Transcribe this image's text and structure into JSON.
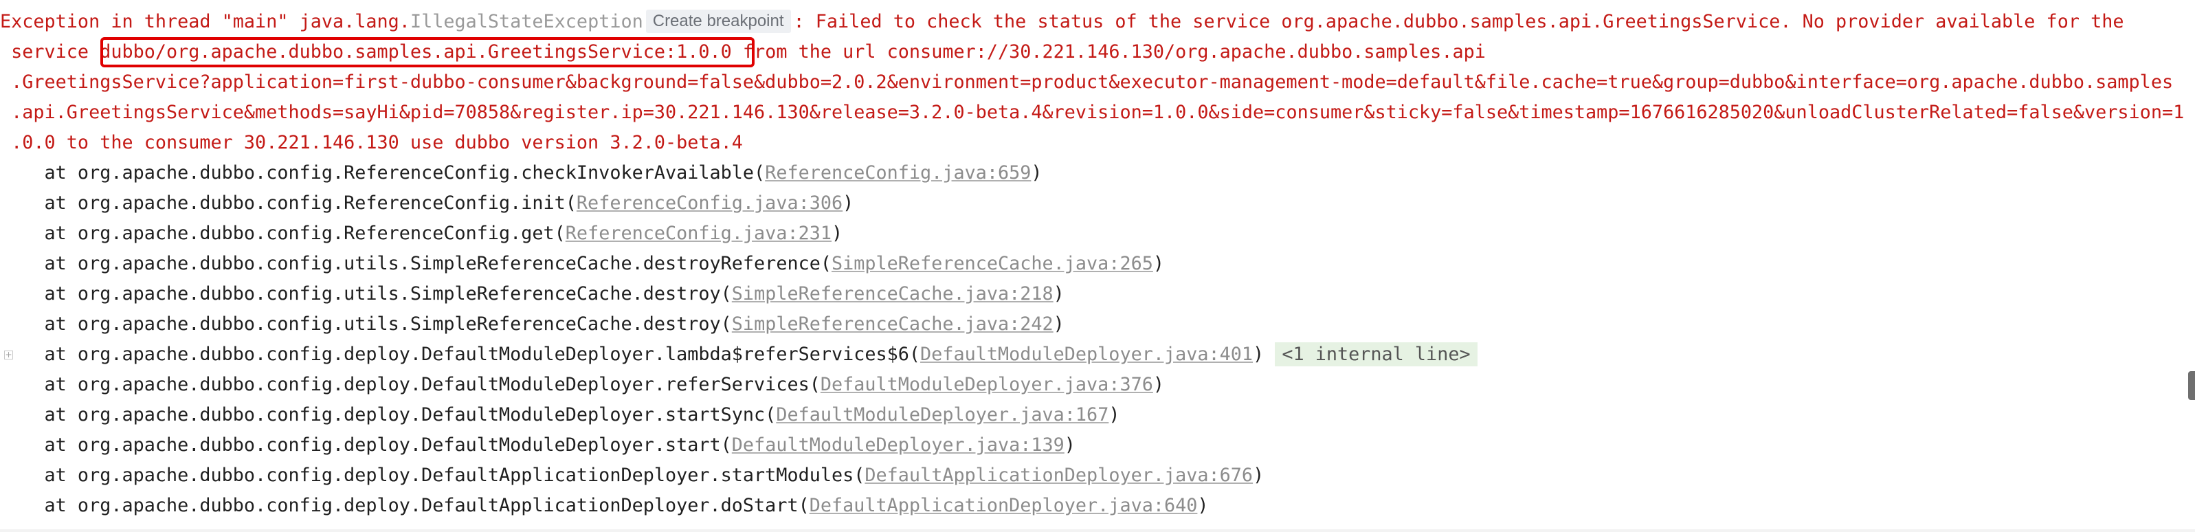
{
  "exception": {
    "prefix": "Exception in thread \"main\" java.lang.",
    "class_name": "IllegalStateException",
    "tooltip": "Create breakpoint",
    "message_rest": ": Failed to check the status of the service org.apache.dubbo.samples.api.GreetingsService. No provider available for the",
    "line2_start": " service ",
    "highlighted": "dubbo/org.apache.dubbo.samples.api.GreetingsService:1.0.0",
    "line2_end": " from the url consumer://30.221.146.130/org.apache.dubbo.samples.api",
    "line3": " .GreetingsService?application=first-dubbo-consumer&background=false&dubbo=2.0.2&environment=product&executor-management-mode=default&file.cache=true&group=dubbo&interface=org.apache.dubbo.samples",
    "line4": " .api.GreetingsService&methods=sayHi&pid=70858&register.ip=30.221.146.130&release=3.2.0-beta.4&revision=1.0.0&side=consumer&sticky=false&timestamp=1676616285020&unloadClusterRelated=false&version=1",
    "line5": " .0.0 to the consumer 30.221.146.130 use dubbo version 3.2.0-beta.4"
  },
  "frames": [
    {
      "method": "    at org.apache.dubbo.config.ReferenceConfig.checkInvokerAvailable(",
      "location": "ReferenceConfig.java:659",
      "close": ")"
    },
    {
      "method": "    at org.apache.dubbo.config.ReferenceConfig.init(",
      "location": "ReferenceConfig.java:306",
      "close": ")"
    },
    {
      "method": "    at org.apache.dubbo.config.ReferenceConfig.get(",
      "location": "ReferenceConfig.java:231",
      "close": ")"
    },
    {
      "method": "    at org.apache.dubbo.config.utils.SimpleReferenceCache.destroyReference(",
      "location": "SimpleReferenceCache.java:265",
      "close": ")"
    },
    {
      "method": "    at org.apache.dubbo.config.utils.SimpleReferenceCache.destroy(",
      "location": "SimpleReferenceCache.java:218",
      "close": ")"
    },
    {
      "method": "    at org.apache.dubbo.config.utils.SimpleReferenceCache.destroy(",
      "location": "SimpleReferenceCache.java:242",
      "close": ")"
    },
    {
      "method": "    at org.apache.dubbo.config.deploy.DefaultModuleDeployer.lambda$referServices$6(",
      "location": "DefaultModuleDeployer.java:401",
      "close": ") ",
      "internal": "<1 internal line>"
    },
    {
      "method": "    at org.apache.dubbo.config.deploy.DefaultModuleDeployer.referServices(",
      "location": "DefaultModuleDeployer.java:376",
      "close": ")"
    },
    {
      "method": "    at org.apache.dubbo.config.deploy.DefaultModuleDeployer.startSync(",
      "location": "DefaultModuleDeployer.java:167",
      "close": ")"
    },
    {
      "method": "    at org.apache.dubbo.config.deploy.DefaultModuleDeployer.start(",
      "location": "DefaultModuleDeployer.java:139",
      "close": ")"
    },
    {
      "method": "    at org.apache.dubbo.config.deploy.DefaultApplicationDeployer.startModules(",
      "location": "DefaultApplicationDeployer.java:676",
      "close": ")"
    },
    {
      "method": "    at org.apache.dubbo.config.deploy.DefaultApplicationDeployer.doStart(",
      "location": "DefaultApplicationDeployer.java:640",
      "close": ")"
    }
  ],
  "fold_icon": "expand-plus-icon",
  "colors": {
    "error": "#c41a16",
    "highlight_border": "#e00000",
    "link": "#8c8c8c",
    "internal_bg": "#e6f2e3"
  }
}
